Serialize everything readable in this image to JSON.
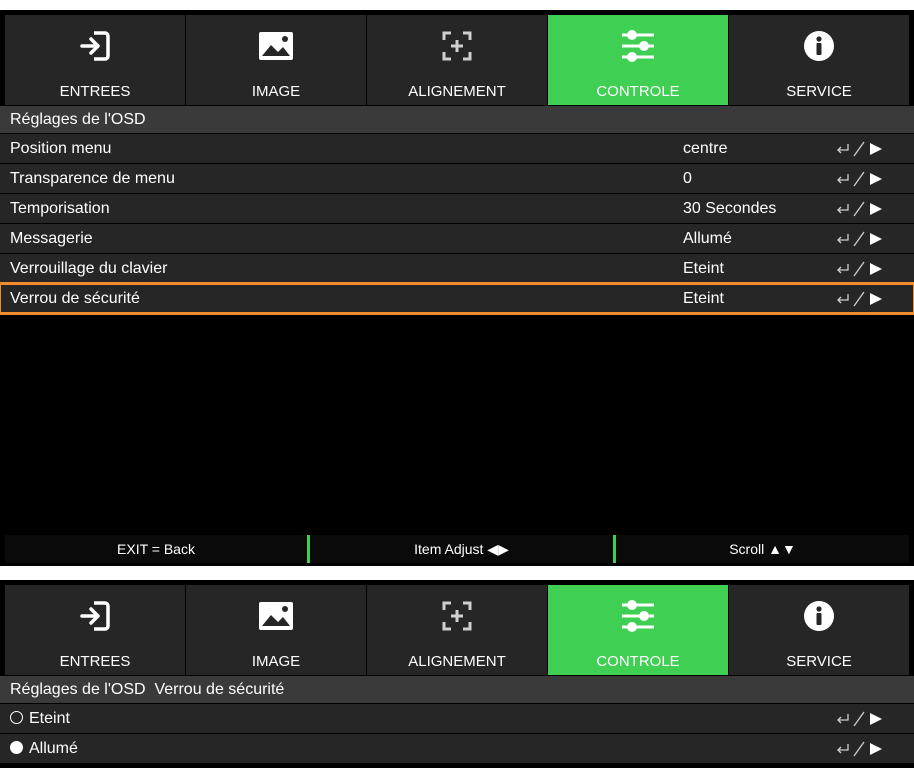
{
  "colors": {
    "accent": "#3fcf52",
    "highlight": "#f28a2e",
    "tab_bg": "#262626",
    "row_bg": "#262626",
    "title_bg": "#3a3a3a"
  },
  "tabs": [
    {
      "label": "ENTREES",
      "icon": "input-icon"
    },
    {
      "label": "IMAGE",
      "icon": "image-icon"
    },
    {
      "label": "ALIGNEMENT",
      "icon": "alignment-icon"
    },
    {
      "label": "CONTROLE",
      "icon": "sliders-icon",
      "active": true
    },
    {
      "label": "SERVICE",
      "icon": "info-icon"
    }
  ],
  "osd": {
    "title": "Réglages de l'OSD",
    "items": [
      {
        "name": "Position menu",
        "value": "centre"
      },
      {
        "name": "Transparence de menu",
        "value": "0"
      },
      {
        "name": "Temporisation",
        "value": "30 Secondes"
      },
      {
        "name": "Messagerie",
        "value": "Allumé"
      },
      {
        "name": "Verrouillage du clavier",
        "value": "Eteint"
      },
      {
        "name": "Verrou de sécurité",
        "value": "Eteint",
        "selected": true
      }
    ]
  },
  "footer": {
    "exit": "EXIT = Back",
    "adjust": "Item Adjust ◀▶",
    "scroll": "Scroll ▲▼"
  },
  "submenu": {
    "title": "Réglages de l'OSD  Verrou de sécurité",
    "options": [
      {
        "label": "Eteint",
        "checked": false
      },
      {
        "label": "Allumé",
        "checked": true
      }
    ]
  }
}
